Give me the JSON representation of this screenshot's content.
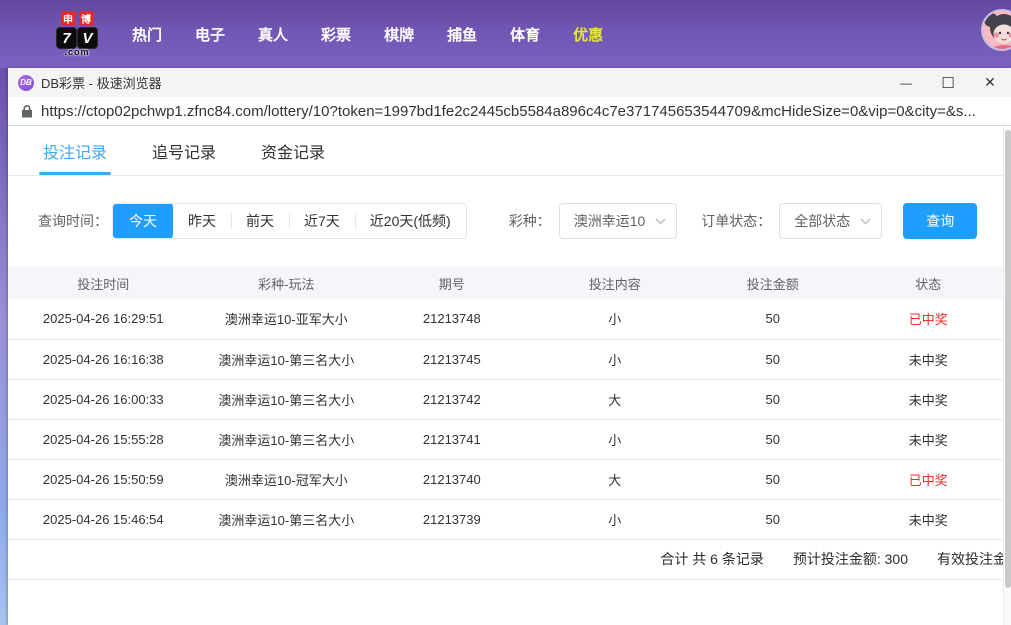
{
  "colors": {
    "accent_blue": "#1e9fff",
    "tab_active_blue": "#3ea9f5",
    "won_red": "#f02c2c",
    "header_purple": "#7157b4",
    "nav_highlight_yellow": "#e6e53e"
  },
  "site_header": {
    "logo": {
      "badge_left": "申",
      "badge_right": "博",
      "tile_left": "7",
      "tile_right": "V",
      "suffix": ".com"
    },
    "nav": [
      {
        "label": "热门"
      },
      {
        "label": "电子"
      },
      {
        "label": "真人"
      },
      {
        "label": "彩票"
      },
      {
        "label": "棋牌"
      },
      {
        "label": "捕鱼"
      },
      {
        "label": "体育"
      },
      {
        "label": "优惠"
      }
    ]
  },
  "browser": {
    "window_icon_text": "DB",
    "window_title": "DB彩票 - 极速浏览器",
    "controls": {
      "minimize": "—",
      "maximize": "☐",
      "close": "✕"
    },
    "url": "https://ctop02pchwp1.zfnc84.com/lottery/10?token=1997bd1fe2c2445cb5584a896c4c7e371745653544709&mcHideSize=0&vip=0&city=&s..."
  },
  "tabs": [
    {
      "label": "投注记录",
      "active": true
    },
    {
      "label": "追号记录",
      "active": false
    },
    {
      "label": "资金记录",
      "active": false
    }
  ],
  "filters": {
    "time_label": "查询时间：",
    "time_options": [
      {
        "label": "今天",
        "active": true
      },
      {
        "label": "昨天",
        "active": false
      },
      {
        "label": "前天",
        "active": false
      },
      {
        "label": "近7天",
        "active": false
      },
      {
        "label": "近20天(低频)",
        "active": false
      }
    ],
    "lottery_label": "彩种：",
    "lottery_value": "澳洲幸运10",
    "status_label": "订单状态：",
    "status_value": "全部状态",
    "search_button": "查询"
  },
  "table": {
    "headers": [
      "投注时间",
      "彩种-玩法",
      "期号",
      "投注内容",
      "投注金额",
      "状态"
    ],
    "rows": [
      {
        "time": "2025-04-26 16:29:51",
        "play": "澳洲幸运10-亚军大小",
        "issue": "21213748",
        "content": "小",
        "amount": "50",
        "status": "已中奖",
        "won": true
      },
      {
        "time": "2025-04-26 16:16:38",
        "play": "澳洲幸运10-第三名大小",
        "issue": "21213745",
        "content": "小",
        "amount": "50",
        "status": "未中奖",
        "won": false
      },
      {
        "time": "2025-04-26 16:00:33",
        "play": "澳洲幸运10-第三名大小",
        "issue": "21213742",
        "content": "大",
        "amount": "50",
        "status": "未中奖",
        "won": false
      },
      {
        "time": "2025-04-26 15:55:28",
        "play": "澳洲幸运10-第三名大小",
        "issue": "21213741",
        "content": "小",
        "amount": "50",
        "status": "未中奖",
        "won": false
      },
      {
        "time": "2025-04-26 15:50:59",
        "play": "澳洲幸运10-冠军大小",
        "issue": "21213740",
        "content": "大",
        "amount": "50",
        "status": "已中奖",
        "won": true
      },
      {
        "time": "2025-04-26 15:46:54",
        "play": "澳洲幸运10-第三名大小",
        "issue": "21213739",
        "content": "小",
        "amount": "50",
        "status": "未中奖",
        "won": false
      }
    ]
  },
  "summary": {
    "total": "合计 共 6 条记录",
    "expected": "预计投注金额: 300",
    "valid": "有效投注金"
  }
}
